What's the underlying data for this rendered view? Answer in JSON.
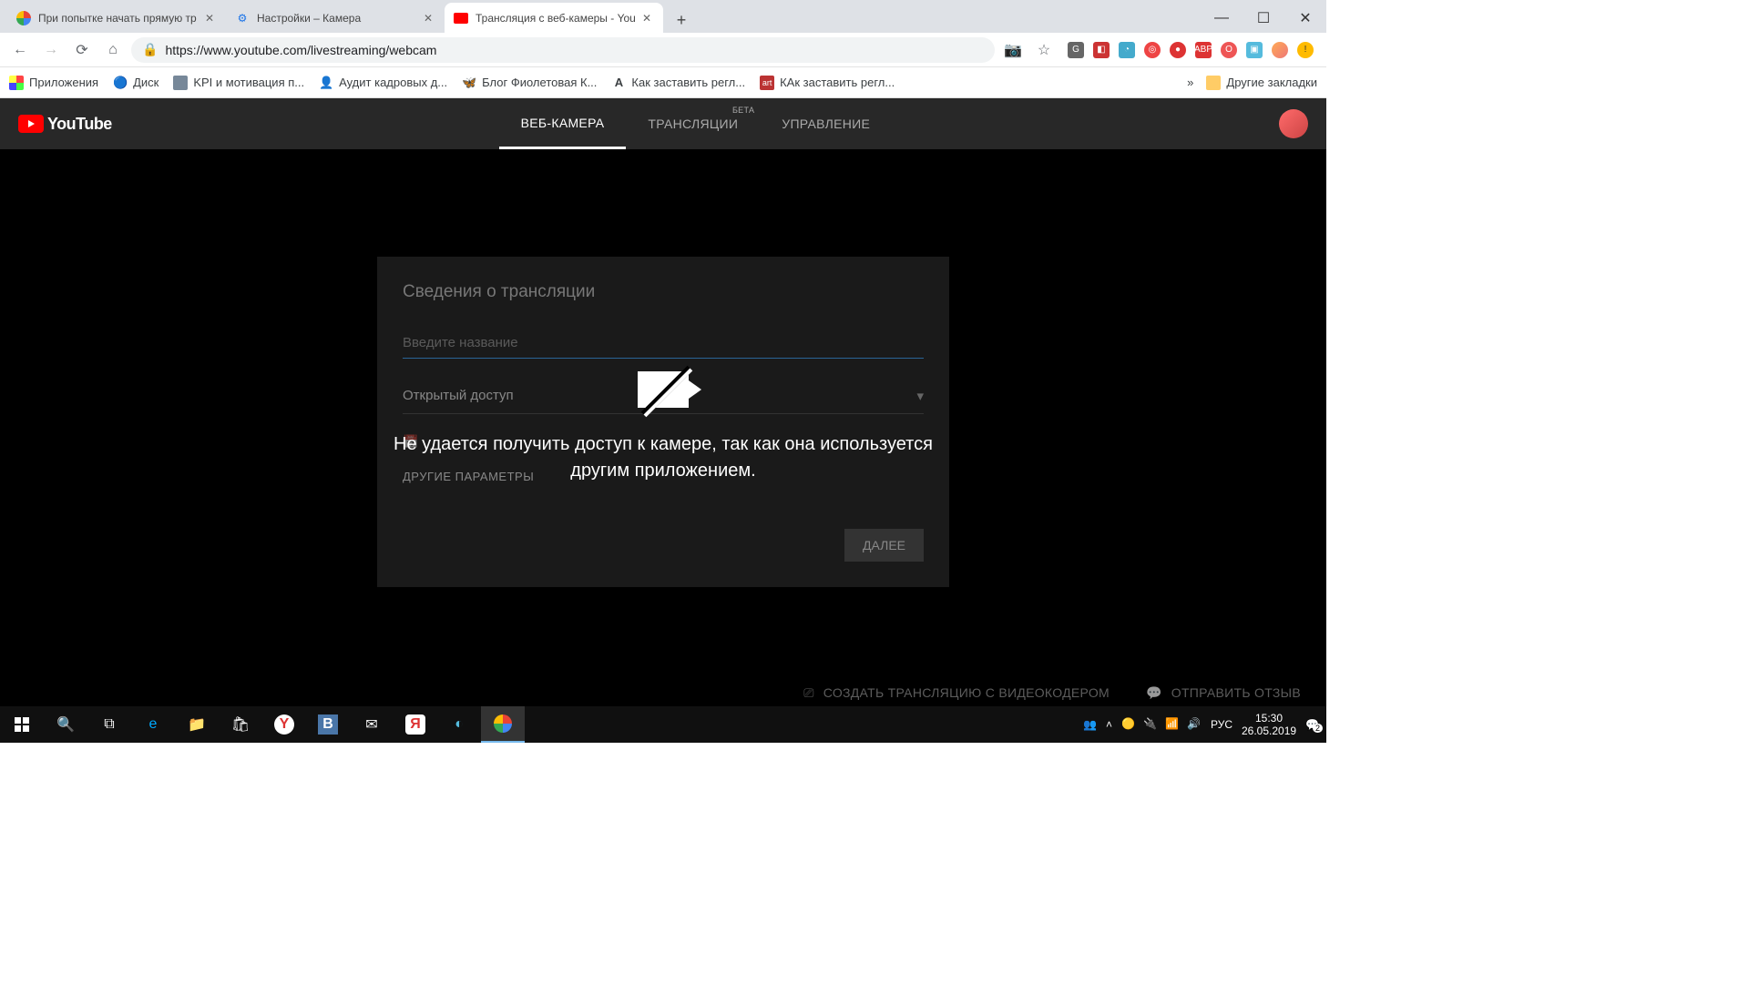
{
  "browser": {
    "tabs": [
      {
        "title": "При попытке начать прямую тр",
        "favicon": "google"
      },
      {
        "title": "Настройки – Камера",
        "favicon": "gear"
      },
      {
        "title": "Трансляция с веб-камеры - You",
        "favicon": "youtube",
        "active": true
      }
    ],
    "url": "https://www.youtube.com/livestreaming/webcam",
    "bookmarks": [
      {
        "label": "Приложения",
        "icon": "apps"
      },
      {
        "label": "Диск",
        "icon": "disk"
      },
      {
        "label": "KPI и мотивация п...",
        "icon": "kpi"
      },
      {
        "label": "Аудит кадровых д...",
        "icon": "audit"
      },
      {
        "label": "Блог Фиолетовая К...",
        "icon": "blog"
      },
      {
        "label": "Как заставить регл...",
        "icon": "a"
      },
      {
        "label": "КАк заставить регл...",
        "icon": "art"
      }
    ],
    "other_bookmarks": "Другие закладки"
  },
  "youtube": {
    "logo": "YouTube",
    "tabs": [
      {
        "label": "ВЕБ-КАМЕРА",
        "active": true
      },
      {
        "label": "ТРАНСЛЯЦИИ",
        "beta": "БЕТА"
      },
      {
        "label": "УПРАВЛЕНИЕ"
      }
    ],
    "panel": {
      "heading": "Сведения о трансляции",
      "title_placeholder": "Введите название",
      "visibility": "Открытый доступ",
      "other_params": "ДРУГИЕ ПАРАМЕТРЫ",
      "next": "ДАЛЕЕ"
    },
    "error": "Не удается получить доступ к камере, так как она используется другим приложением.",
    "bottom": {
      "encoder": "СОЗДАТЬ ТРАНСЛЯЦИЮ С ВИДЕОКОДЕРОМ",
      "feedback": "ОТПРАВИТЬ ОТЗЫВ"
    }
  },
  "taskbar": {
    "lang": "РУС",
    "time": "15:30",
    "date": "26.05.2019",
    "notif": "2"
  }
}
